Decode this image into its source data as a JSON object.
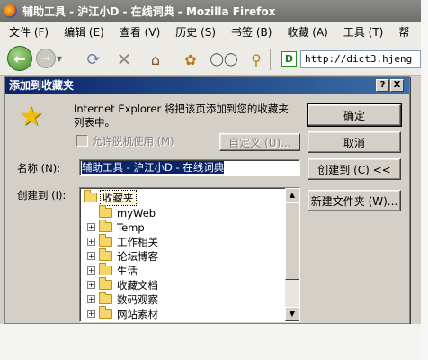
{
  "browser": {
    "title": "辅助工具 - 沪江小D - 在线词典 - Mozilla Firefox",
    "menu": [
      "文件 (F)",
      "编辑 (E)",
      "查看 (V)",
      "历史 (S)",
      "书签 (B)",
      "收藏 (A)",
      "工具 (T)",
      "帮"
    ],
    "favicon_letter": "D",
    "url": "http://dict3.hjeng"
  },
  "dialog": {
    "title": "添加到收藏夹",
    "help_label": "?",
    "close_label": "X",
    "info_text": "Internet Explorer 将把该页添加到您的收藏夹列表中。",
    "offline_label": "允许脱机使用 (M)",
    "customize_label": "自定义 (U)...",
    "ok_label": "确定",
    "cancel_label": "取消",
    "name_label": "名称 (N):",
    "name_value": "辅助工具 - 沪江小D - 在线词典",
    "create_in_toggle_label": "创建到 (C) <<",
    "create_in_label": "创建到 (I):",
    "new_folder_label": "新建文件夹 (W)...",
    "tree": {
      "root": "收藏夹",
      "items": [
        {
          "label": "myWeb",
          "expandable": false
        },
        {
          "label": "Temp",
          "expandable": true
        },
        {
          "label": "工作相关",
          "expandable": true
        },
        {
          "label": "论坛博客",
          "expandable": true
        },
        {
          "label": "生活",
          "expandable": true
        },
        {
          "label": "收藏文档",
          "expandable": true
        },
        {
          "label": "数码观察",
          "expandable": true
        },
        {
          "label": "网站素材",
          "expandable": true
        }
      ]
    }
  },
  "icons": {
    "back": "back-arrow-icon",
    "forward": "forward-arrow-icon",
    "reload": "reload-icon",
    "stop": "stop-icon",
    "home": "home-icon",
    "bug": "bug-icon",
    "glasses": "glasses-icon",
    "key": "key-icon",
    "star": "star-icon",
    "folder": "folder-icon"
  },
  "colors": {
    "dialog_title_start": "#0a246a",
    "dialog_title_end": "#3a6ea5",
    "selection": "#0a246a",
    "folder": "#f5d66a",
    "star": "#f0c000"
  }
}
